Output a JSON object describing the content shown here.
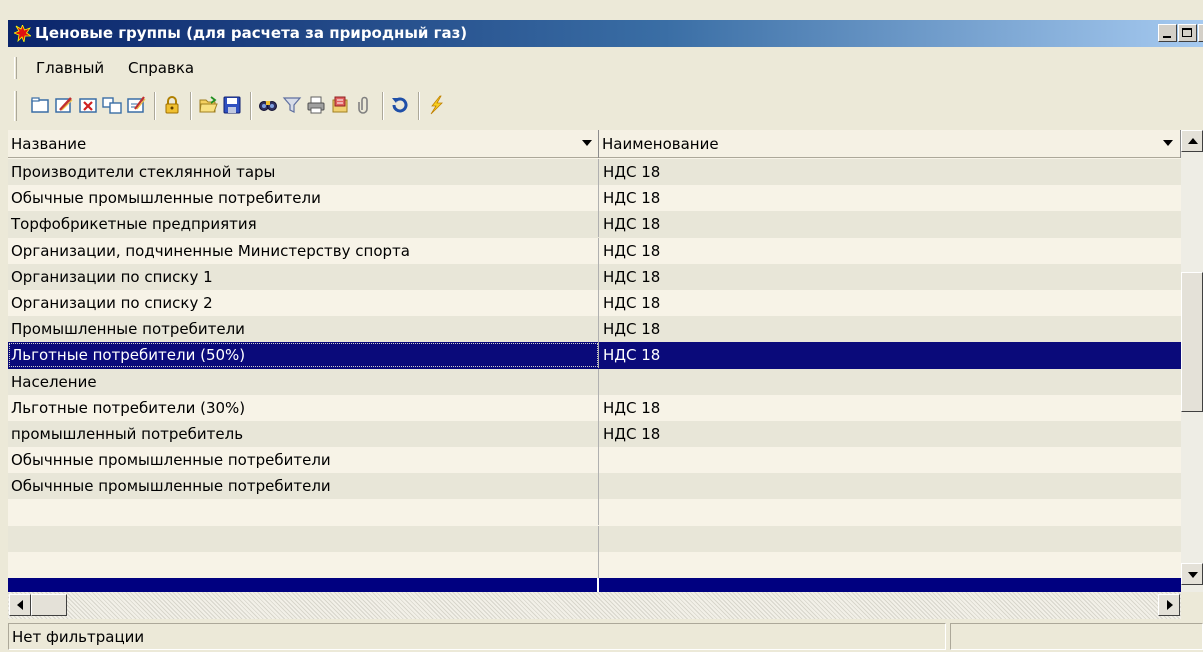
{
  "window": {
    "title": "Ценовые группы (для расчета за природный газ)",
    "app_icon": "red-star-icon",
    "buttons": [
      "minimize-icon",
      "maximize-icon",
      "close-icon"
    ]
  },
  "menu": {
    "items": [
      {
        "label": "Главный"
      },
      {
        "label": "Справка"
      }
    ]
  },
  "toolbar": {
    "icons": [
      "new-folder-icon",
      "edit-icon",
      "delete-icon",
      "copy-icon",
      "edit-list-icon",
      "lock-icon",
      "open-folder-icon",
      "save-icon",
      "binoculars-icon",
      "filter-icon",
      "print-icon",
      "export-icon",
      "attach-icon",
      "refresh-icon",
      "lightning-icon"
    ]
  },
  "grid": {
    "columns": [
      {
        "label": "Название"
      },
      {
        "label": "Наименование"
      }
    ],
    "rows": [
      {
        "name": "Производители стеклянной тары",
        "naim": "НДС 18"
      },
      {
        "name": "Обычные промышленные потребители",
        "naim": "НДС 18"
      },
      {
        "name": "Торфобрикетные предприятия",
        "naim": "НДС 18"
      },
      {
        "name": "Организации, подчиненные Министерству спорта",
        "naim": "НДС 18"
      },
      {
        "name": "Организации по списку 1",
        "naim": "НДС 18"
      },
      {
        "name": "Организации по списку 2",
        "naim": "НДС 18"
      },
      {
        "name": "Промышленные потребители",
        "naim": "НДС 18"
      },
      {
        "name": "Льготные потребители (50%)",
        "naim": "НДС 18",
        "selected": true
      },
      {
        "name": "Население",
        "naim": ""
      },
      {
        "name": "Льготные потребители (30%)",
        "naim": "НДС 18"
      },
      {
        "name": "промышленный потребитель",
        "naim": "НДС 18"
      },
      {
        "name": "Обычнные промышленные потребители",
        "naim": ""
      },
      {
        "name": "Обычнные промышленные потребители",
        "naim": ""
      }
    ]
  },
  "status": {
    "text": "Нет фильтрации"
  },
  "colors": {
    "selection": "#0a0a7a",
    "title_gradient_start": "#0a246a",
    "row_odd": "#e8e6d8",
    "row_even": "#f7f3e7"
  }
}
